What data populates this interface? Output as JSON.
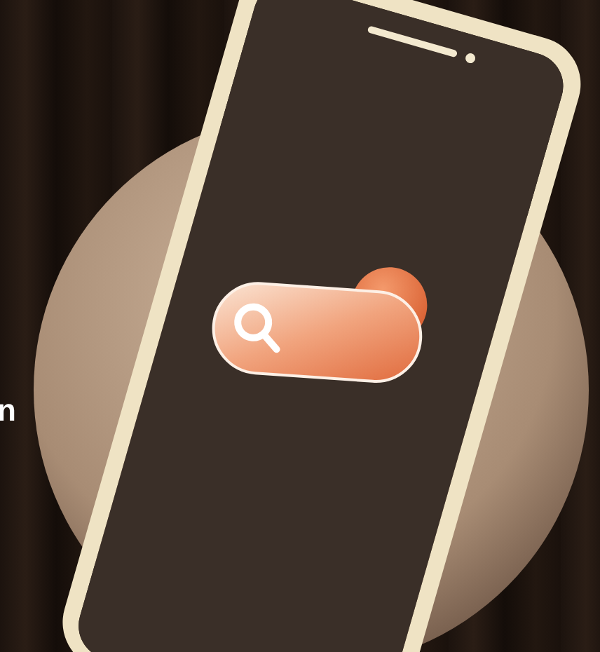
{
  "side_text": {
    "text": "n"
  }
}
